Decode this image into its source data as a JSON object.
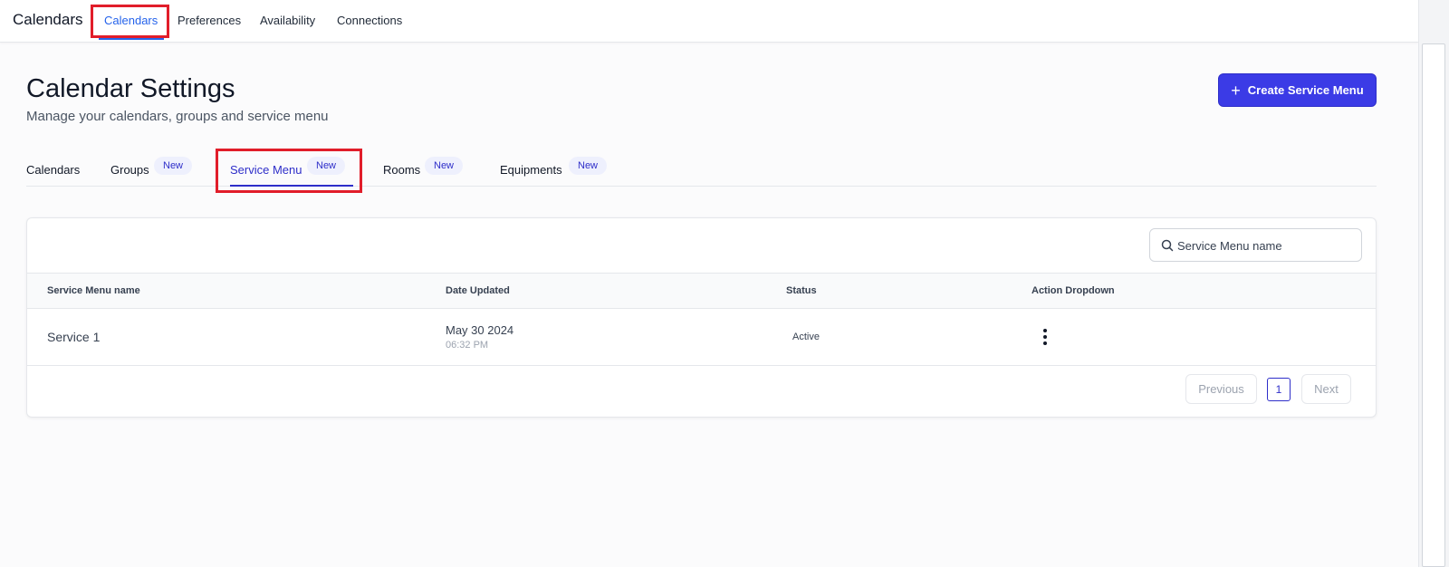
{
  "topnav": {
    "app_title": "Calendars",
    "items": [
      {
        "label": "Calendars",
        "active": true
      },
      {
        "label": "Preferences"
      },
      {
        "label": "Availability"
      },
      {
        "label": "Connections"
      }
    ]
  },
  "header": {
    "title": "Calendar Settings",
    "subtitle": "Manage your calendars, groups and service menu",
    "create_button_label": "Create Service Menu"
  },
  "tabs": [
    {
      "label": "Calendars"
    },
    {
      "label": "Groups",
      "badge": "New"
    },
    {
      "label": "Service Menu",
      "badge": "New",
      "active": true
    },
    {
      "label": "Rooms",
      "badge": "New"
    },
    {
      "label": "Equipments",
      "badge": "New"
    }
  ],
  "search": {
    "placeholder": "Service Menu name"
  },
  "table": {
    "columns": [
      "Service Menu name",
      "Date Updated",
      "Status",
      "Action Dropdown"
    ],
    "rows": [
      {
        "name": "Service 1",
        "date": "May 30 2024",
        "time": "06:32 PM",
        "status": "Active"
      }
    ]
  },
  "pagination": {
    "previous": "Previous",
    "current_page": "1",
    "next": "Next"
  },
  "colors": {
    "accent": "#3b3be6",
    "highlight": "#e11d2a",
    "nav_active": "#2563eb"
  }
}
